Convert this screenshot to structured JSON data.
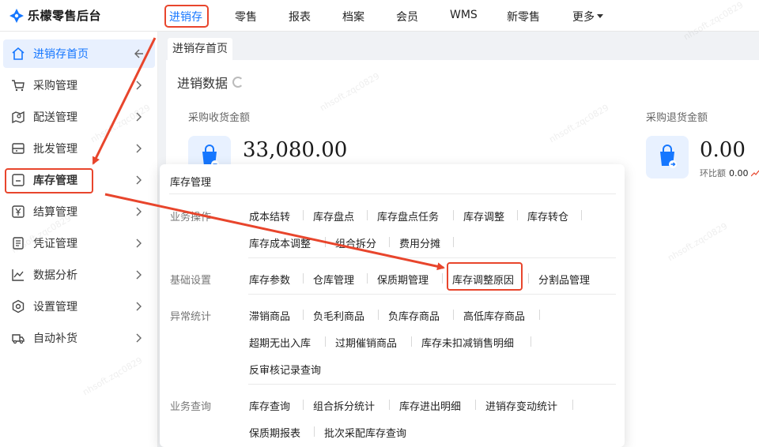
{
  "app": {
    "title": "乐檬零售后台"
  },
  "topnav": {
    "items": [
      {
        "label": "进销存",
        "active": true
      },
      {
        "label": "零售"
      },
      {
        "label": "报表"
      },
      {
        "label": "档案"
      },
      {
        "label": "会员"
      },
      {
        "label": "WMS"
      },
      {
        "label": "新零售"
      },
      {
        "label": "更多"
      }
    ]
  },
  "sidebar": {
    "items": [
      {
        "label": "进销存首页",
        "icon": "home-icon",
        "active": true
      },
      {
        "label": "采购管理",
        "icon": "cart-icon"
      },
      {
        "label": "配送管理",
        "icon": "map-icon"
      },
      {
        "label": "批发管理",
        "icon": "store-icon"
      },
      {
        "label": "库存管理",
        "icon": "box-icon"
      },
      {
        "label": "结算管理",
        "icon": "money-icon"
      },
      {
        "label": "凭证管理",
        "icon": "document-icon"
      },
      {
        "label": "数据分析",
        "icon": "chart-icon"
      },
      {
        "label": "设置管理",
        "icon": "settings-icon"
      },
      {
        "label": "自动补货",
        "icon": "truck-icon"
      }
    ]
  },
  "tabs": [
    {
      "label": "进销存首页"
    }
  ],
  "dashboard": {
    "title": "进销数据",
    "metrics": [
      {
        "label": "采购收货金额",
        "value": "33,080.00"
      },
      {
        "label": "采购退货金额",
        "value": "0.00",
        "sub_label": "环比额",
        "sub_value": "0.00"
      }
    ]
  },
  "watermark": "nhsoft.zqc0829",
  "dropdown": {
    "title": "库存管理",
    "sections": [
      {
        "label": "业务操作",
        "rows": [
          [
            "成本结转",
            "库存盘点",
            "库存盘点任务",
            "库存调整",
            "库存转仓"
          ],
          [
            "库存成本调整",
            "组合拆分",
            "费用分摊"
          ]
        ]
      },
      {
        "label": "基础设置",
        "rows": [
          [
            "库存参数",
            "仓库管理",
            "保质期管理",
            "库存调整原因",
            "分割品管理"
          ]
        ]
      },
      {
        "label": "异常统计",
        "rows": [
          [
            "滞销商品",
            "负毛利商品",
            "负库存商品",
            "高低库存商品"
          ],
          [
            "超期无出入库",
            "过期催销商品",
            "库存未扣减销售明细"
          ],
          [
            "反审核记录查询"
          ]
        ]
      },
      {
        "label": "业务查询",
        "rows": [
          [
            "库存查询",
            "组合拆分统计",
            "库存进出明细",
            "进销存变动统计"
          ],
          [
            "保质期报表",
            "批次采配库存查询"
          ]
        ]
      }
    ]
  },
  "colors": {
    "accent": "#1677ff",
    "highlight": "#e8452c",
    "active_bg": "#e8f0fe"
  }
}
